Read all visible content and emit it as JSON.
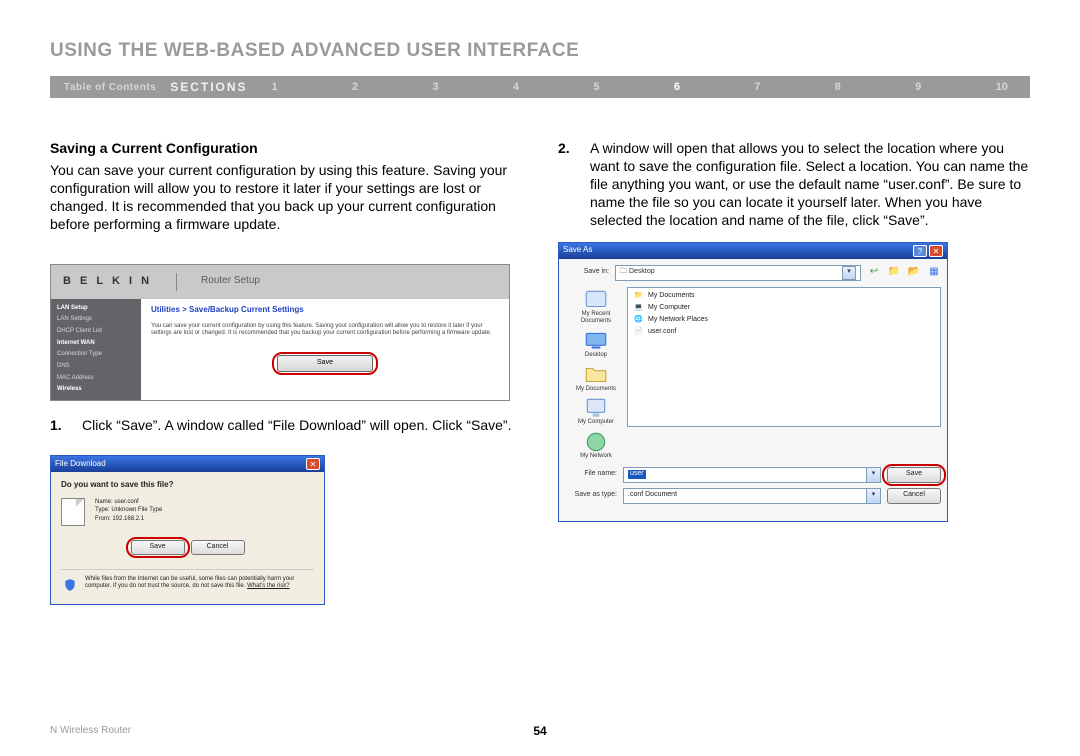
{
  "page": {
    "title": "USING THE WEB-BASED ADVANCED USER INTERFACE",
    "footer_left": "N Wireless Router",
    "page_number": "54"
  },
  "sections_bar": {
    "toc": "Table of Contents",
    "label": "SECTIONS",
    "numbers": [
      "1",
      "2",
      "3",
      "4",
      "5",
      "6",
      "7",
      "8",
      "9",
      "10"
    ],
    "active_index": 5
  },
  "left_col": {
    "heading": "Saving a Current Configuration",
    "paragraph": "You can save your current configuration by using this feature. Saving your configuration will allow you to restore it later if your settings are lost or changed. It is recommended that you back up your current configuration before performing a firmware update.",
    "step1_num": "1.",
    "step1_text": "Click “Save”. A window called “File Download” will open. Click “Save”."
  },
  "right_col": {
    "step2_num": "2.",
    "step2_text": "A window will open that allows you to select the location where you want to save the configuration file. Select a location. You can name the file anything you want, or use the default name “user.conf”. Be sure to name the file so you can locate it yourself later. When you have selected the location and name of the file, click “Save”."
  },
  "router_shot": {
    "brand": "B E L K I N",
    "product": "Router Setup",
    "breadcrumb": "Utilities > Save/Backup Current Settings",
    "desc": "You can save your current configuration by using this feature. Saving your configuration will allow you to restore it later if your settings are lost or changed. It is recommended that you backup your current configuration before performing a firmware update.",
    "save_btn": "Save",
    "sidebar": {
      "lan_setup": "LAN Setup",
      "lan_settings": "LAN Settings",
      "dhcp": "DHCP Client List",
      "wan": "Internet WAN",
      "conn": "Connection Type",
      "dns": "DNS",
      "mac": "MAC Address",
      "wireless": "Wireless"
    }
  },
  "file_download": {
    "title": "File Download",
    "question": "Do you want to save this file?",
    "name_label": "Name:",
    "name_value": "user.conf",
    "type_label": "Type:",
    "type_value": "Unknown File Type",
    "from_label": "From:",
    "from_value": "192.168.2.1",
    "save_btn": "Save",
    "cancel_btn": "Cancel",
    "warn_text": "While files from the Internet can be useful, some files can potentially harm your computer. If you do not trust the source, do not save this file. ",
    "risk_link": "What's the risk?"
  },
  "save_as": {
    "title": "Save As",
    "save_in_label": "Save in:",
    "save_in_value": "Desktop",
    "side_icons": [
      "My Recent Documents",
      "Desktop",
      "My Documents",
      "My Computer",
      "My Network"
    ],
    "list_items": [
      "My Documents",
      "My Computer",
      "My Network Places",
      "user.conf"
    ],
    "file_name_label": "File name:",
    "file_name_value": "user",
    "save_type_label": "Save as type:",
    "save_type_value": ".conf Document",
    "save_btn": "Save",
    "cancel_btn": "Cancel"
  }
}
